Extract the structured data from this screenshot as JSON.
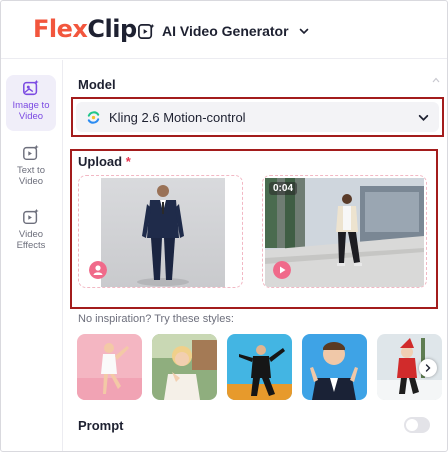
{
  "header": {
    "logo_left": "Flex",
    "logo_right": "Clip",
    "tool_name": "AI Video Generator",
    "tool_icon": "video-sparkle-icon"
  },
  "rail": {
    "items": [
      {
        "label_line1": "Image to",
        "label_line2": "Video",
        "icon": "image-sparkle-icon",
        "active": true
      },
      {
        "label_line1": "Text to",
        "label_line2": "Video",
        "icon": "text-video-icon",
        "active": false
      },
      {
        "label_line1": "Video",
        "label_line2": "Effects",
        "icon": "video-effects-icon",
        "active": false
      }
    ]
  },
  "model": {
    "title": "Model",
    "selected": "Kling 2.6 Motion-control",
    "icon": "kling-logo-icon"
  },
  "upload": {
    "title": "Upload",
    "required_mark": "*",
    "image_slot_icon": "person-badge-icon",
    "video_slot_icon": "play-badge-icon",
    "video_duration": "0:04"
  },
  "inspiration": {
    "text": "No inspiration? Try these styles:",
    "styles": [
      "style-pink-dancer",
      "style-selfie-girl",
      "style-suit-pose",
      "style-man-pointing",
      "style-santa"
    ]
  },
  "prompt": {
    "title": "Prompt",
    "enabled": false
  },
  "colors": {
    "brand_orange": "#f2563d",
    "accent_purple": "#7b4ae2",
    "highlight_border": "#a31c1c",
    "required_red": "#e8344f",
    "badge_pink": "#f06a8a"
  }
}
